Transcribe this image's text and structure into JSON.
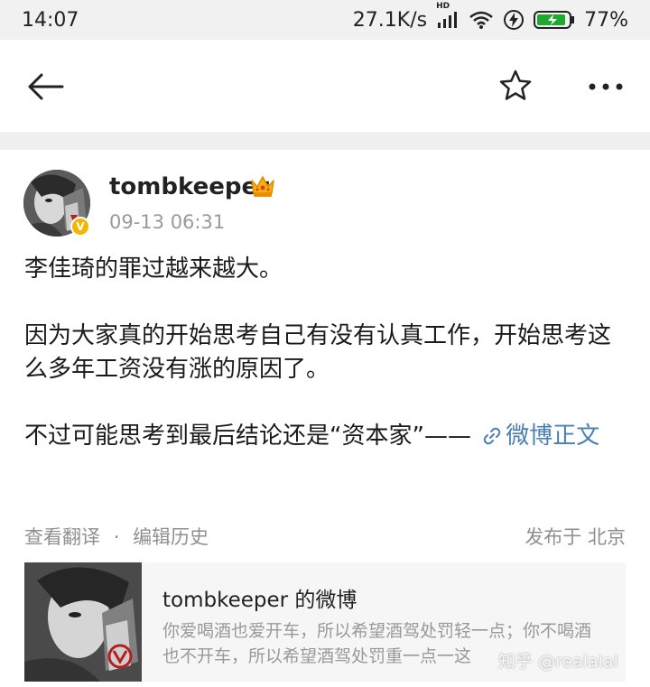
{
  "status_bar": {
    "time": "14:07",
    "network_speed": "27.1K/s",
    "network_type": "HD",
    "battery_percent": "77%",
    "icons": [
      "signal-icon",
      "wifi-icon",
      "charging-icon",
      "battery-icon"
    ]
  },
  "top_bar": {
    "icons": [
      "back-arrow-icon",
      "star-icon",
      "more-icon"
    ]
  },
  "post": {
    "username": "tombkeeper",
    "timestamp": "09-13 06:31",
    "verified_badge": "V",
    "paragraphs": [
      "李佳琦的罪过越来越大。",
      "因为大家真的开始思考自己有没有认真工作，开始思考这么多年工资没有涨的原因了。"
    ],
    "last_paragraph_text": "不过可能思考到最后结论还是“资本家”——",
    "link_text": "微博正文",
    "translate_label": "查看翻译",
    "separator": "·",
    "edit_history_label": "编辑历史",
    "location": "发布于 北京"
  },
  "card": {
    "title": "tombkeeper 的微博",
    "description": "你爱喝酒也爱开车，所以希望酒驾处罚轻一点；你不喝酒也不开车，所以希望酒驾处罚重一点一这"
  },
  "watermark": "知乎 @realalal",
  "colors": {
    "link": "#4a7fb5",
    "verified": "#f2b600",
    "muted": "#9a9a9a"
  }
}
